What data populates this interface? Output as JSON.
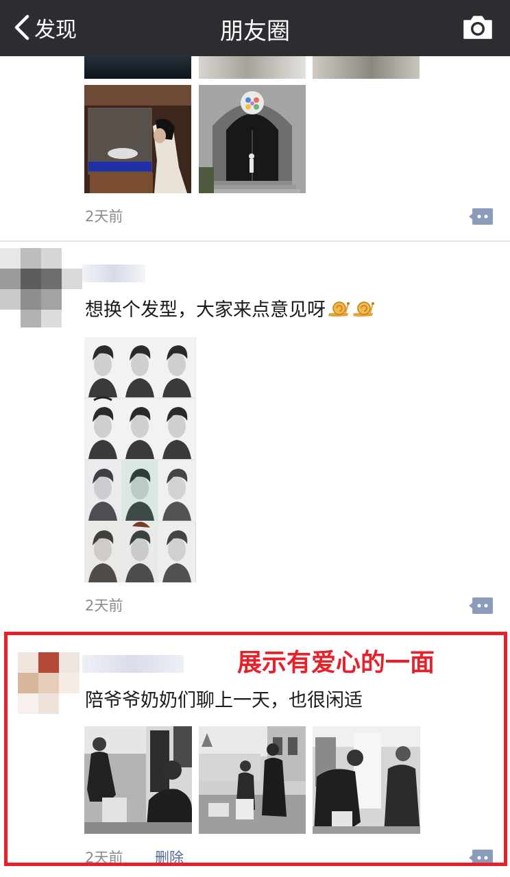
{
  "nav": {
    "back_label": "发现",
    "title": "朋友圈",
    "camera_icon": "camera-icon"
  },
  "posts": [
    {
      "time": "2天前"
    },
    {
      "text": "想换个发型，大家来点意见呀",
      "emoji": "snail",
      "time": "2天前"
    },
    {
      "text": "陪爷爷奶奶们聊上一天，也很闲适",
      "time": "2天前",
      "delete_label": "删除"
    }
  ],
  "annotation": {
    "label": "展示有爱心的一面",
    "color": "#e8202a"
  },
  "colors": {
    "navbar": "#2d2d31",
    "link": "#576b95",
    "timestamp": "#8c8c8c"
  }
}
